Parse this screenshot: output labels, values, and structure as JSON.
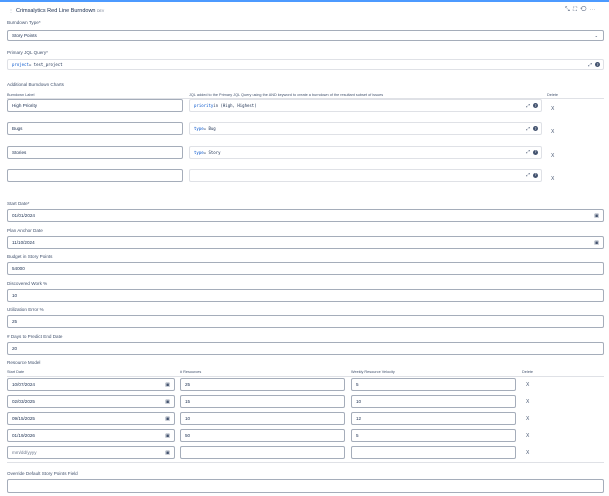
{
  "header": {
    "title": "Crimsalytics Red Line Burndown",
    "badge": "DEV"
  },
  "burndown_type": {
    "label": "Burndown Type*",
    "value": "Story Points"
  },
  "primary_jql": {
    "label": "Primary JQL Query*",
    "keyword": "project",
    "rest": " = test_project"
  },
  "additional": {
    "title": "Additional Burndown Charts",
    "col_label": "Burndown Label",
    "col_jql": "JQL added to the Primary JQL Query using the AND keyword to create a burndown of the resultant subset of issues",
    "col_delete": "Delete",
    "rows": [
      {
        "label": "High Priority",
        "kw": "priority",
        "rest": " in (High, Highest)"
      },
      {
        "label": "Bugs",
        "kw": "type",
        "rest": " = Bug"
      },
      {
        "label": "Stories",
        "kw": "type",
        "rest": " = Story"
      },
      {
        "label": "",
        "kw": "",
        "rest": ""
      }
    ],
    "delete": "X"
  },
  "fields": [
    {
      "label": "Start Date*",
      "value": "01/01/2024",
      "date": true
    },
    {
      "label": "Plan Anchor Date",
      "value": "11/10/2024",
      "date": true
    },
    {
      "label": "Budget in Story Points",
      "value": "54000"
    },
    {
      "label": "Discovered Work %",
      "value": "10"
    },
    {
      "label": "Utilization Error %",
      "value": "25"
    },
    {
      "label": "# Days to Predict End Date",
      "value": "20"
    }
  ],
  "resource": {
    "title": "Resource Model",
    "col_start": "Start Date",
    "col_res": "# Resources",
    "col_vel": "Weekly Resource Velocity",
    "col_delete": "Delete",
    "placeholder": "mm/dd/yyyy",
    "rows": [
      {
        "date": "10/07/2024",
        "res": "25",
        "vel": "5"
      },
      {
        "date": "02/03/2025",
        "res": "15",
        "vel": "10"
      },
      {
        "date": "09/15/2025",
        "res": "10",
        "vel": "12"
      },
      {
        "date": "01/19/2026",
        "res": "50",
        "vel": "5"
      },
      {
        "date": "",
        "res": "",
        "vel": ""
      }
    ]
  },
  "override": {
    "label": "Override Default Story Points Field",
    "value": ""
  }
}
